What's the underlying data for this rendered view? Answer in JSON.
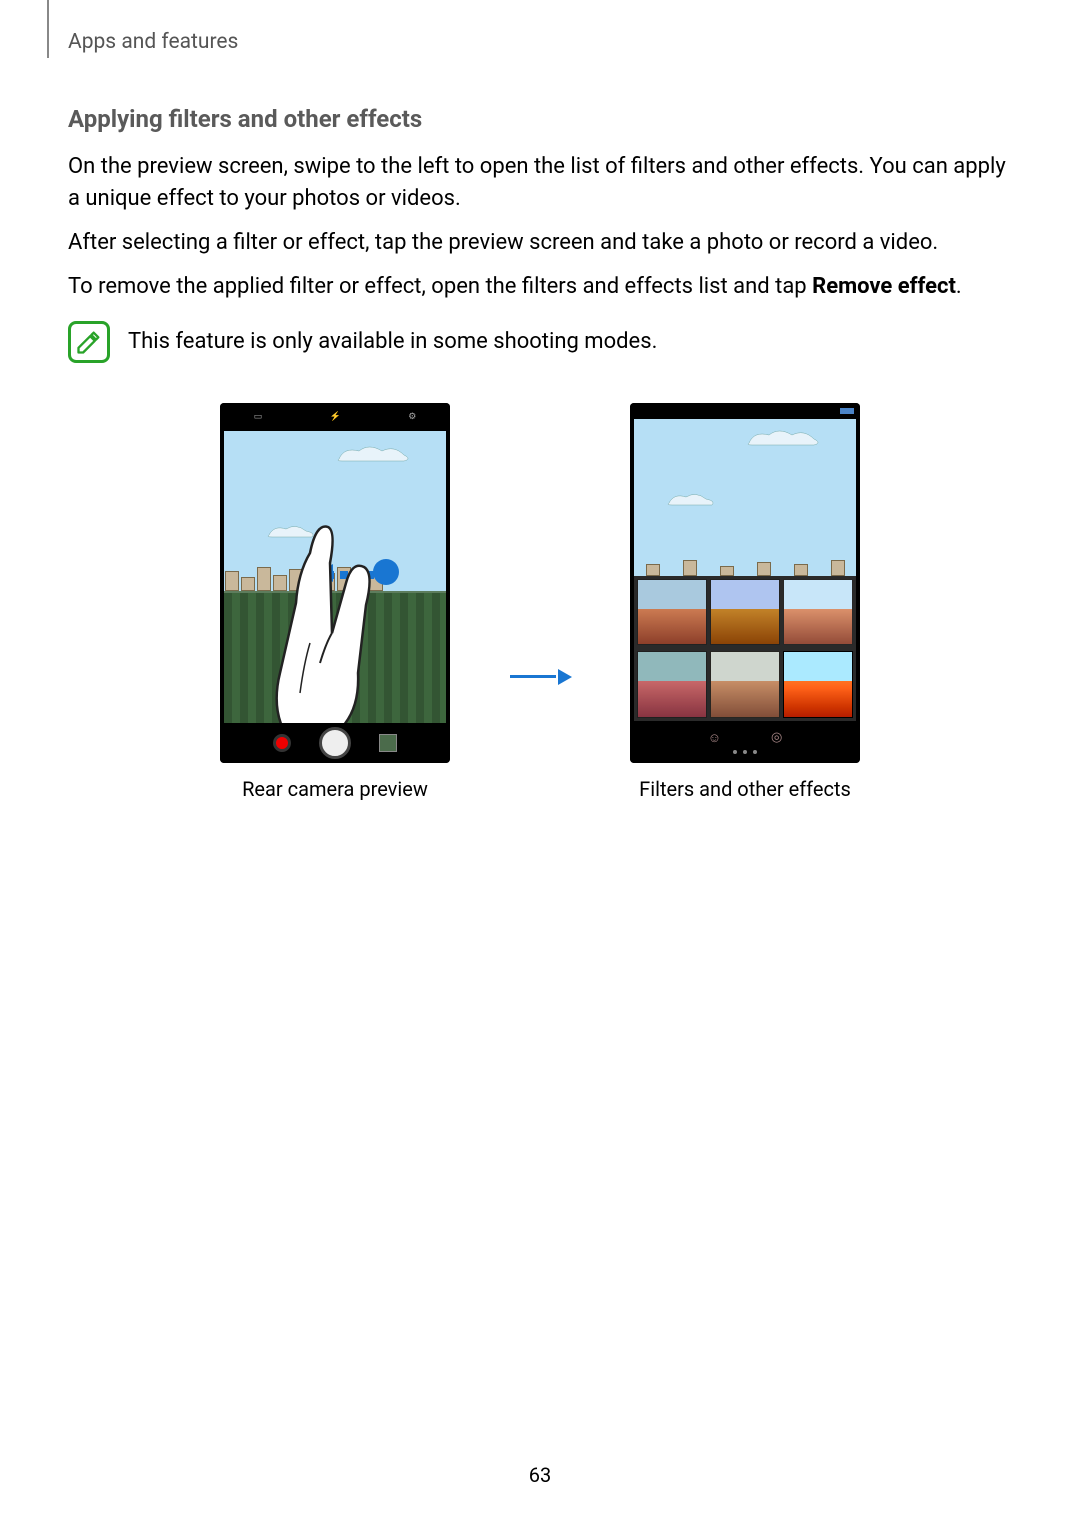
{
  "header": {
    "breadcrumb": "Apps and features"
  },
  "section": {
    "title": "Applying filters and other effects",
    "p1": "On the preview screen, swipe to the left to open the list of filters and other effects. You can apply a unique effect to your photos or videos.",
    "p2": "After selecting a filter or effect, tap the preview screen and take a photo or record a video.",
    "p3_pre": "To remove the applied filter or effect, open the filters and effects list and tap ",
    "p3_bold": "Remove effect",
    "p3_post": "."
  },
  "note": {
    "icon": "note-pencil-icon",
    "text": "This feature is only available in some shooting modes."
  },
  "figure": {
    "left_caption": "Rear camera preview",
    "right_caption": "Filters and other effects"
  },
  "page_number": "63"
}
